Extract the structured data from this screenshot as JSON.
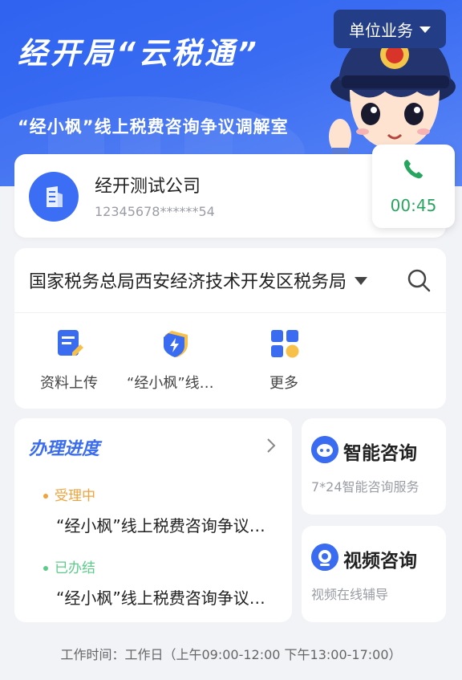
{
  "banner": {
    "title": "经开局“云税通”",
    "subtitle": "“经小枫”线上税费咨询争议调解室",
    "unit_button_label": "单位业务"
  },
  "company": {
    "name": "经开测试公司",
    "id": "12345678******54"
  },
  "call": {
    "timer": "00:45",
    "color": "#27a55f"
  },
  "bureau": {
    "name": "国家税务总局西安经济技术开发区税务局",
    "quick_actions": [
      {
        "label": "资料上传",
        "icon": "document-edit-icon"
      },
      {
        "label": "“经小枫”线上税费咨询",
        "icon": "shield-lightning-icon"
      },
      {
        "label": "更多",
        "icon": "grid-more-icon"
      }
    ]
  },
  "progress": {
    "title": "办理进度",
    "items": [
      {
        "status": "受理中",
        "status_color": "#f0a23b",
        "text": "“经小枫”线上税费咨询争议调解"
      },
      {
        "status": "已办结",
        "status_color": "#5ccb8a",
        "text": "“经小枫”线上税费咨询争议调解"
      }
    ]
  },
  "smart_consult": {
    "title": "智能咨询",
    "desc": "7*24智能咨询服务"
  },
  "video_consult": {
    "title": "视频咨询",
    "desc": "视频在线辅导"
  },
  "footer": {
    "work_hours": "工作时间：工作日（上午09:00-12:00 下午13:00-17:00）"
  },
  "colors": {
    "accent": "#3a6cf2",
    "banner_bg": "#2f63f0",
    "unit_button_bg": "#233e86"
  }
}
